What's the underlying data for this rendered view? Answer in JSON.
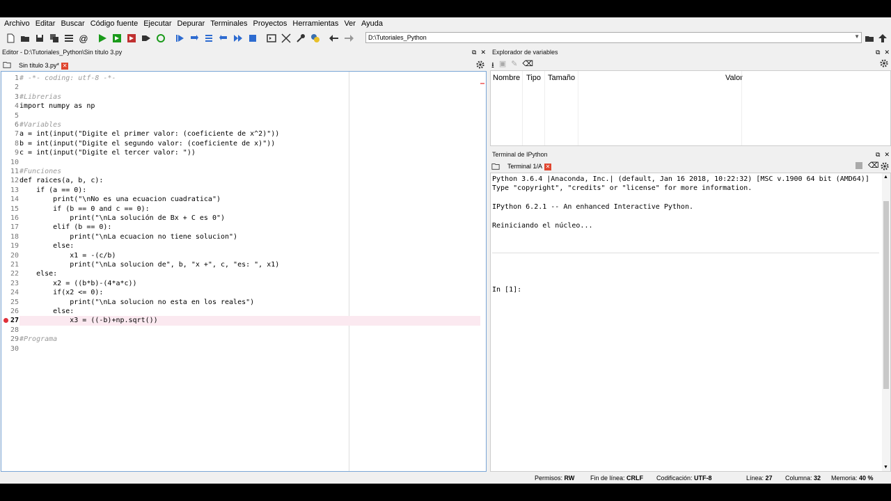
{
  "menu": [
    "Archivo",
    "Editar",
    "Buscar",
    "Código fuente",
    "Ejecutar",
    "Depurar",
    "Terminales",
    "Proyectos",
    "Herramientas",
    "Ver",
    "Ayuda"
  ],
  "toolbar": {
    "path": "D:\\Tutoriales_Python"
  },
  "editor": {
    "title": "Editor - D:\\Tutoriales_Python\\Sin título 3.py",
    "tab": "Sin título 3.py*",
    "lines": [
      {
        "n": "1",
        "t": "# -*- coding: utf-8 -*-",
        "c": true
      },
      {
        "n": "2",
        "t": ""
      },
      {
        "n": "3",
        "t": "#Librerias",
        "c": true
      },
      {
        "n": "4",
        "t": "import numpy as np"
      },
      {
        "n": "5",
        "t": ""
      },
      {
        "n": "6",
        "t": "#Variables",
        "c": true
      },
      {
        "n": "7",
        "t": "a = int(input(\"Digite el primer valor: (coeficiente de x^2)\"))"
      },
      {
        "n": "8",
        "t": "b = int(input(\"Digite el segundo valor: (coeficiente de x)\"))"
      },
      {
        "n": "9",
        "t": "c = int(input(\"Digite el tercer valor: \"))"
      },
      {
        "n": "10",
        "t": ""
      },
      {
        "n": "11",
        "t": "#Funciones",
        "c": true
      },
      {
        "n": "12",
        "t": "def raices(a, b, c):"
      },
      {
        "n": "13",
        "t": "    if (a == 0):"
      },
      {
        "n": "14",
        "t": "        print(\"\\nNo es una ecuacion cuadratica\")"
      },
      {
        "n": "15",
        "t": "        if (b == 0 and c == 0):"
      },
      {
        "n": "16",
        "t": "            print(\"\\nLa solución de Bx + C es 0\")"
      },
      {
        "n": "17",
        "t": "        elif (b == 0):"
      },
      {
        "n": "18",
        "t": "            print(\"\\nLa ecuacion no tiene solucion\")"
      },
      {
        "n": "19",
        "t": "        else:"
      },
      {
        "n": "20",
        "t": "            x1 = -(c/b)"
      },
      {
        "n": "21",
        "t": "            print(\"\\nLa solucion de\", b, \"x +\", c, \"es: \", x1)"
      },
      {
        "n": "22",
        "t": "    else:"
      },
      {
        "n": "23",
        "t": "        x2 = ((b*b)-(4*a*c))"
      },
      {
        "n": "24",
        "t": "        if(x2 <= 0):"
      },
      {
        "n": "25",
        "t": "            print(\"\\nLa solucion no esta en los reales\")"
      },
      {
        "n": "26",
        "t": "        else:"
      },
      {
        "n": "27",
        "t": "            x3 = ((-b)+np.sqrt())",
        "cur": true
      },
      {
        "n": "28",
        "t": ""
      },
      {
        "n": "29",
        "t": "#Programa",
        "c": true
      },
      {
        "n": "30",
        "t": ""
      }
    ]
  },
  "variable_explorer": {
    "title": "Explorador de variables",
    "columns": [
      "Nombre",
      "Tipo",
      "Tamaño",
      "Valor"
    ]
  },
  "console": {
    "title": "Terminal de IPython",
    "tab": "Terminal 1/A",
    "lines": [
      "Python 3.6.4 |Anaconda, Inc.| (default, Jan 16 2018, 10:22:32) [MSC v.1900 64 bit (AMD64)]",
      "Type \"copyright\", \"credits\" or \"license\" for more information.",
      "",
      "IPython 6.2.1 -- An enhanced Interactive Python.",
      "",
      "Reiniciando el núcleo..."
    ],
    "prompt": "In [1]:"
  },
  "statusbar": {
    "permisos_label": "Permisos:",
    "permisos": "RW",
    "eol_label": "Fin de línea:",
    "eol": "CRLF",
    "enc_label": "Codificación:",
    "enc": "UTF-8",
    "line_label": "Línea:",
    "line": "27",
    "col_label": "Columna:",
    "col": "32",
    "mem_label": "Memoria:",
    "mem": "40 %"
  }
}
